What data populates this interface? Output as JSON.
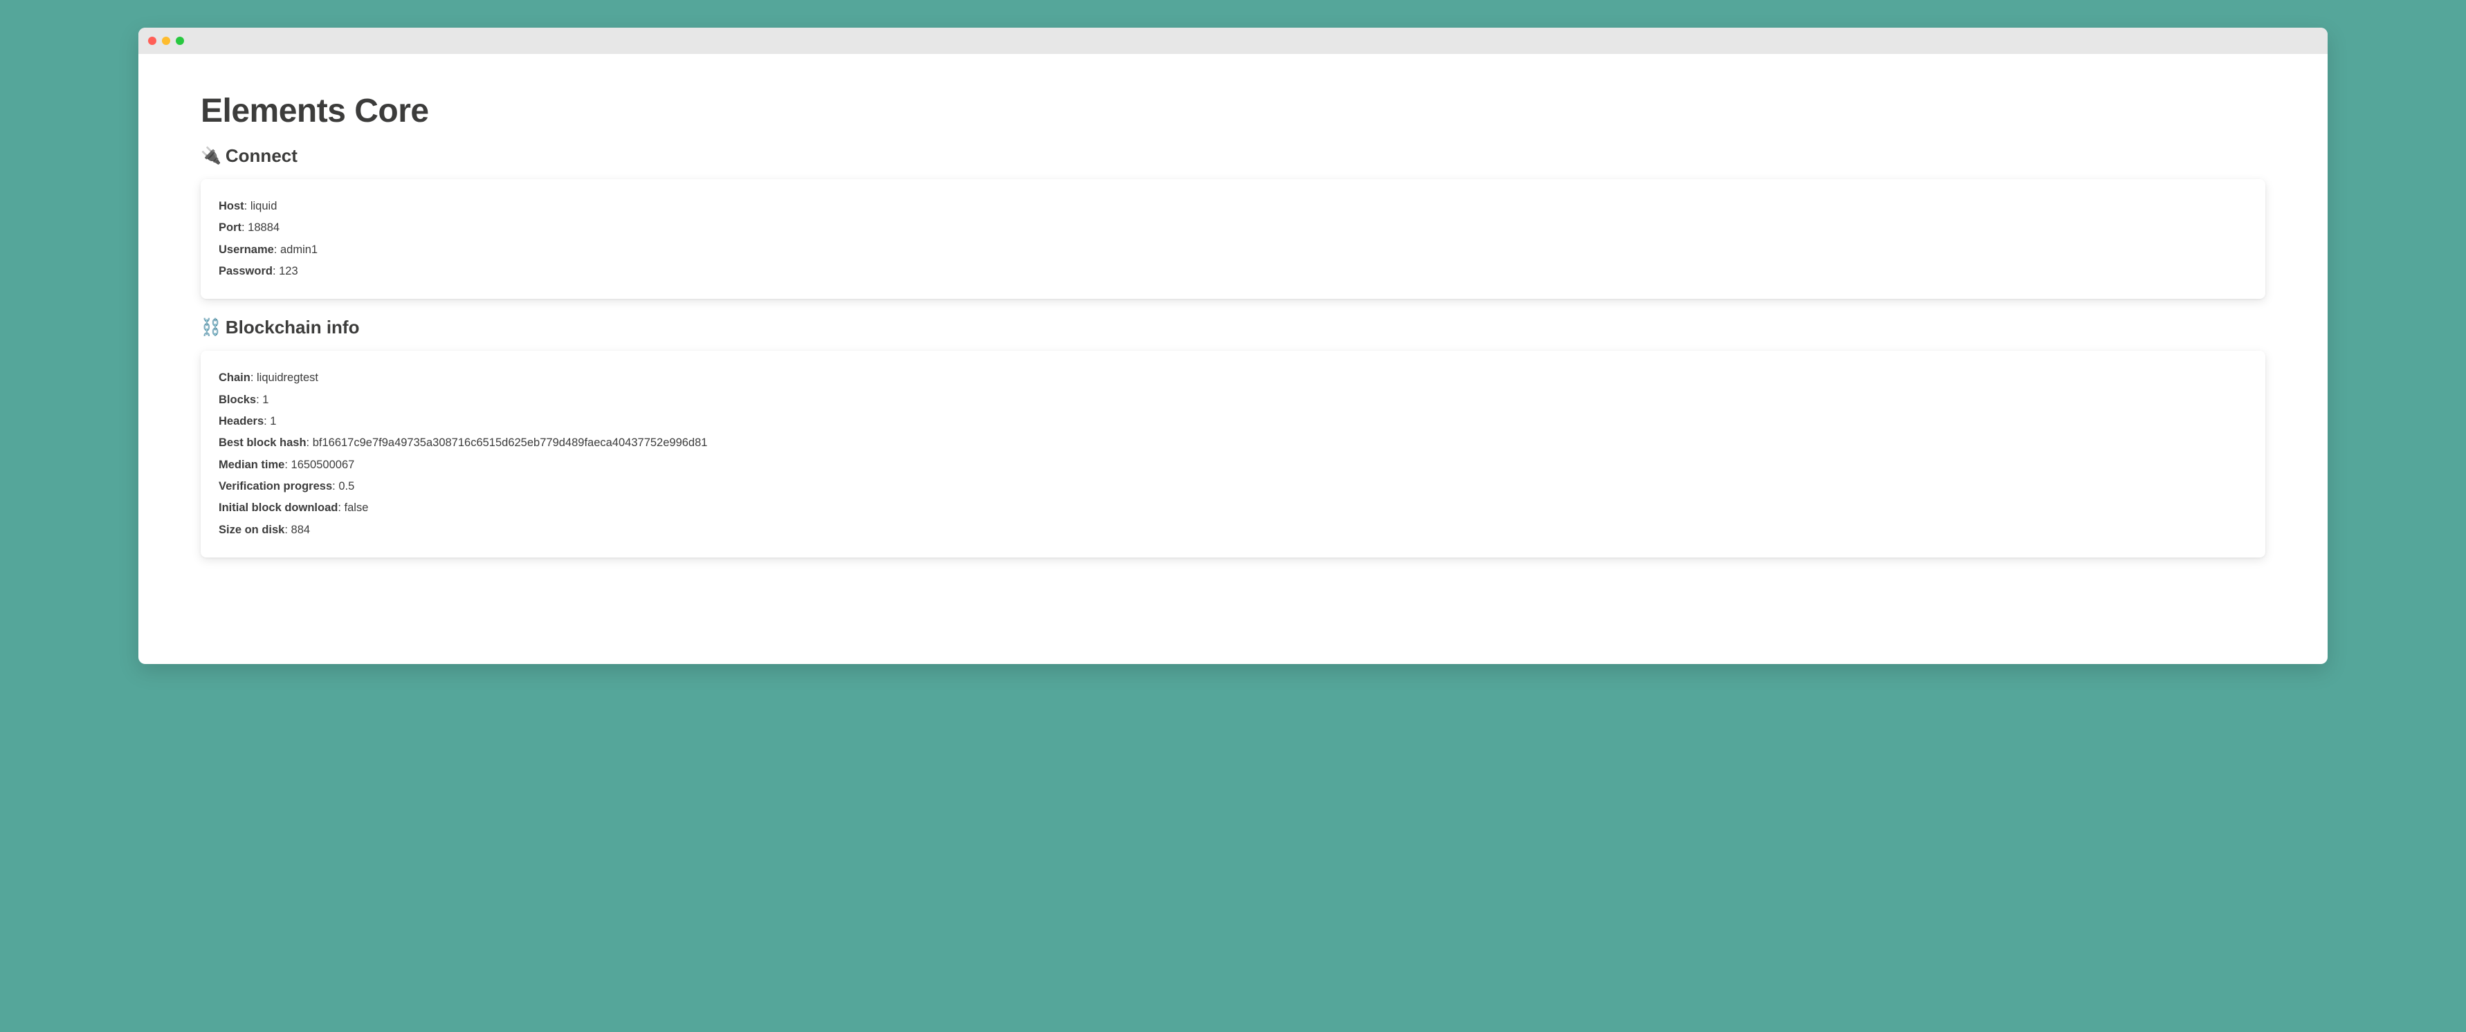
{
  "title": "Elements Core",
  "sections": {
    "connect": {
      "icon": "🔌",
      "heading": "Connect",
      "rows": [
        {
          "label": "Host",
          "sep": ": ",
          "value": "liquid"
        },
        {
          "label": "Port",
          "sep": ": ",
          "value": "18884"
        },
        {
          "label": "Username",
          "sep": ": ",
          "value": "admin1"
        },
        {
          "label": "Password",
          "sep": ": ",
          "value": "123"
        }
      ]
    },
    "blockchain": {
      "icon": "⛓️",
      "heading": "Blockchain info",
      "rows": [
        {
          "label": "Chain",
          "sep": ": ",
          "value": "liquidregtest"
        },
        {
          "label": "Blocks",
          "sep": ": ",
          "value": "1"
        },
        {
          "label": "Headers",
          "sep": ": ",
          "value": "1"
        },
        {
          "label": "Best block hash",
          "sep": ": ",
          "value": "bf16617c9e7f9a49735a308716c6515d625eb779d489faeca40437752e996d81"
        },
        {
          "label": "Median time",
          "sep": ": ",
          "value": "1650500067"
        },
        {
          "label": "Verification progress",
          "sep": ": ",
          "value": "0.5"
        },
        {
          "label": "Initial block download",
          "sep": ": ",
          "value": "false"
        },
        {
          "label": "Size on disk",
          "sep": ": ",
          "value": "884"
        }
      ]
    }
  }
}
